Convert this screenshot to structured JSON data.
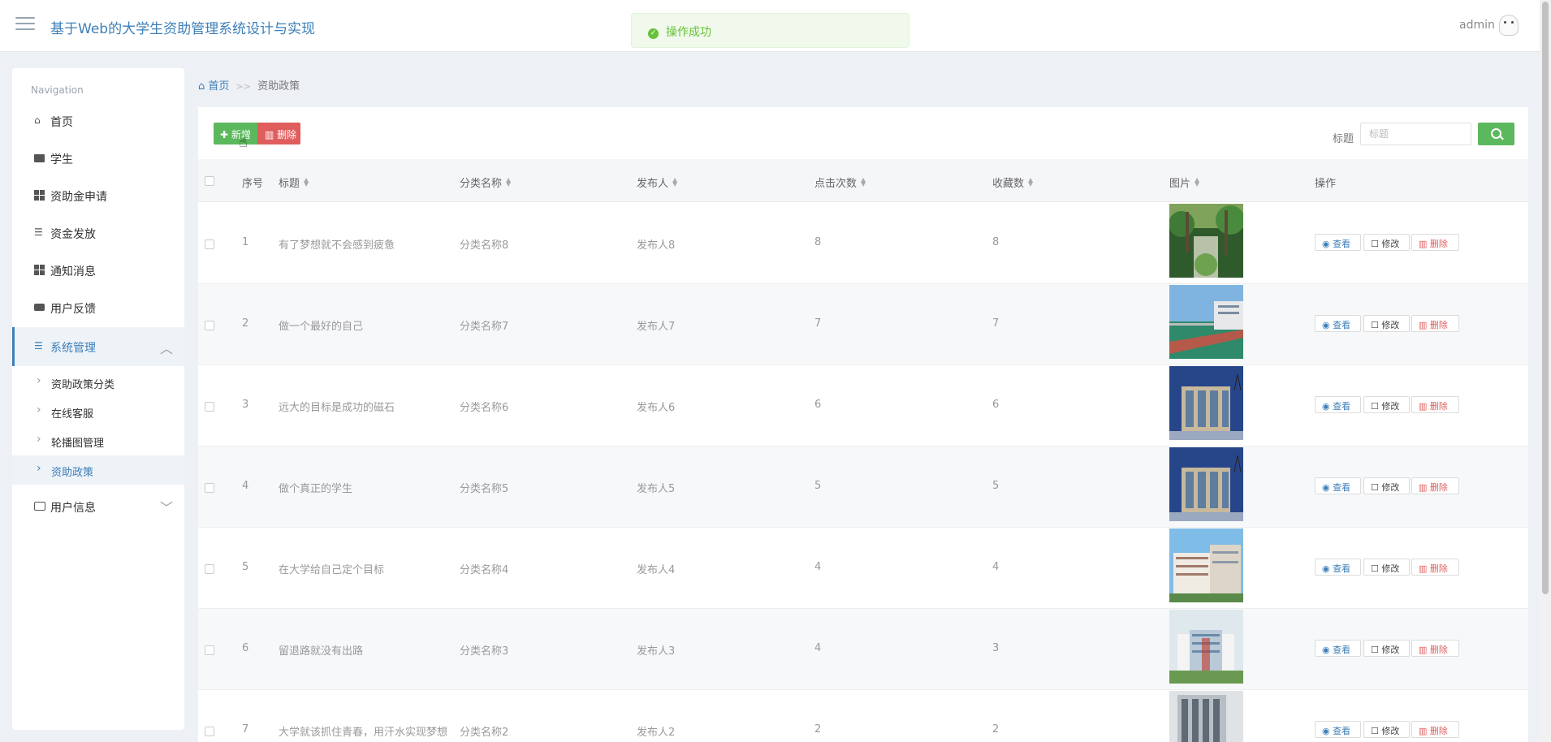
{
  "header": {
    "site_title": "基于Web的大学生资助管理系统设计与实现",
    "toast": "操作成功",
    "user": "admin"
  },
  "sidebar": {
    "heading": "Navigation",
    "items": [
      {
        "label": "首页",
        "icon": "home-icon"
      },
      {
        "label": "学生",
        "icon": "briefcase-icon"
      },
      {
        "label": "资助金申请",
        "icon": "grid-icon"
      },
      {
        "label": "资金发放",
        "icon": "sliders-icon"
      },
      {
        "label": "通知消息",
        "icon": "grid-icon"
      },
      {
        "label": "用户反馈",
        "icon": "printer-icon"
      },
      {
        "label": "系统管理",
        "icon": "list-icon",
        "expanded": true
      },
      {
        "label": "用户信息",
        "icon": "card-icon",
        "expanded": false
      }
    ],
    "sub_items": [
      "资助政策分类",
      "在线客服",
      "轮播图管理",
      "资助政策"
    ],
    "selected_sub": "资助政策"
  },
  "breadcrumb": {
    "home": "首页",
    "separator": ">>",
    "current": "资助政策"
  },
  "toolbar": {
    "add": "新增",
    "delete": "删除"
  },
  "filter": {
    "label": "标题",
    "placeholder": "标题"
  },
  "table": {
    "columns": [
      "序号",
      "标题",
      "分类名称",
      "发布人",
      "点击次数",
      "收藏数",
      "图片",
      "操作"
    ],
    "actions": {
      "view": "查看",
      "edit": "修改",
      "delete": "删除"
    },
    "rows": [
      {
        "no": "1",
        "title": "有了梦想就不会感到疲惫",
        "category": "分类名称8",
        "publisher": "发布人8",
        "clicks": "8",
        "favorites": "8",
        "image": "garden"
      },
      {
        "no": "2",
        "title": "做一个最好的自己",
        "category": "分类名称7",
        "publisher": "发布人7",
        "clicks": "7",
        "favorites": "7",
        "image": "track"
      },
      {
        "no": "3",
        "title": "远大的目标是成功的磁石",
        "category": "分类名称6",
        "publisher": "发布人6",
        "clicks": "6",
        "favorites": "6",
        "image": "building-blue"
      },
      {
        "no": "4",
        "title": "做个真正的学生",
        "category": "分类名称5",
        "publisher": "发布人5",
        "clicks": "5",
        "favorites": "5",
        "image": "building-blue"
      },
      {
        "no": "5",
        "title": "在大学给自己定个目标",
        "category": "分类名称4",
        "publisher": "发布人4",
        "clicks": "4",
        "favorites": "4",
        "image": "building-sky"
      },
      {
        "no": "6",
        "title": "留退路就没有出路",
        "category": "分类名称3",
        "publisher": "发布人3",
        "clicks": "4",
        "favorites": "3",
        "image": "building-render"
      },
      {
        "no": "7",
        "title": "大学就该抓住青春，用汗水实现梦想",
        "category": "分类名称2",
        "publisher": "发布人2",
        "clicks": "2",
        "favorites": "2",
        "image": "building-grey"
      }
    ]
  }
}
